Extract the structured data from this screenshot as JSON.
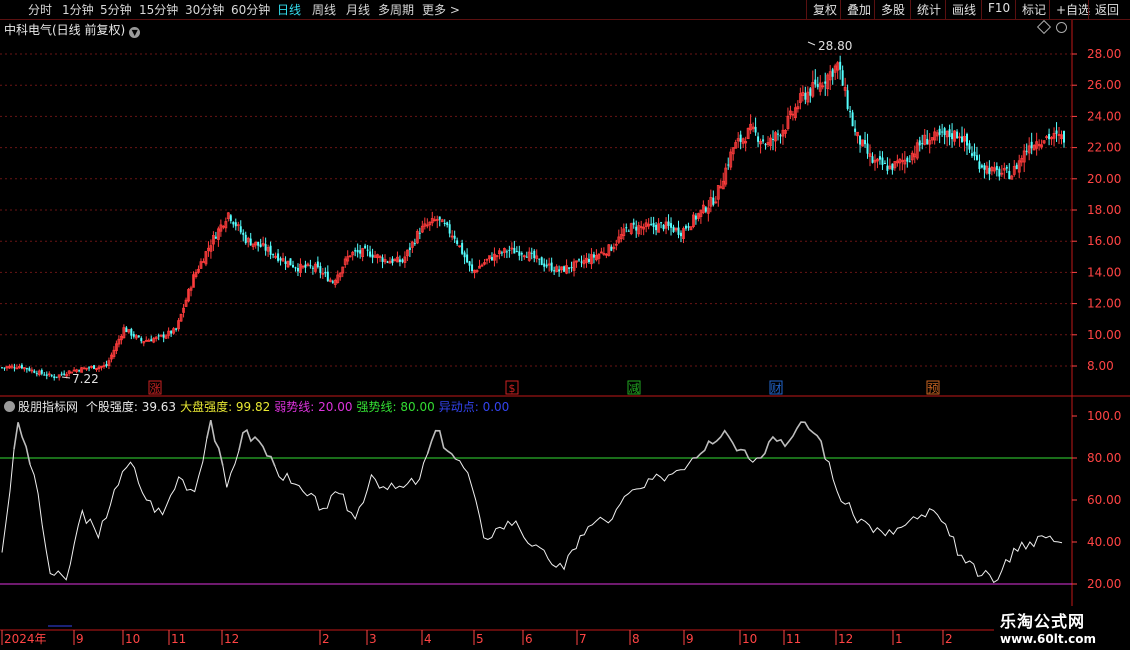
{
  "toolbar": {
    "periods": [
      "分时",
      "1分钟",
      "5分钟",
      "15分钟",
      "30分钟",
      "60分钟",
      "日线",
      "周线",
      "月线",
      "多周期",
      "更多 >"
    ],
    "active_period": "日线",
    "right_buttons": [
      "复权",
      "叠加",
      "多股",
      "统计",
      "画线",
      "F10",
      "标记",
      "+自选",
      "返回"
    ]
  },
  "stock": {
    "title": "中科电气(日线 前复权)"
  },
  "price_axis": {
    "labels": [
      "28.00",
      "26.00",
      "24.00",
      "22.00",
      "20.00",
      "18.00",
      "16.00",
      "14.00",
      "12.00",
      "10.00",
      "8.00"
    ]
  },
  "price_annotations": {
    "high": "28.80",
    "low": "7.22"
  },
  "event_markers": [
    {
      "label": "涨",
      "color": "#cc2222"
    },
    {
      "label": "$",
      "color": "#cc2222"
    },
    {
      "label": "减",
      "color": "#22aa22"
    },
    {
      "label": "财",
      "color": "#2266cc"
    },
    {
      "label": "预",
      "color": "#cc6622"
    }
  ],
  "indicator": {
    "name": "股朋指标网",
    "items": [
      {
        "label": "个股强度: 39.63",
        "color": "#e8e8e8"
      },
      {
        "label": "大盘强度: 99.82",
        "color": "#e8e833"
      },
      {
        "label": "弱势线: 20.00",
        "color": "#dd33dd"
      },
      {
        "label": "强势线: 80.00",
        "color": "#33dd33"
      },
      {
        "label": "异动点: 0.00",
        "color": "#3344ee"
      }
    ],
    "axis_labels": [
      "100.0",
      "80.00",
      "60.00",
      "40.00",
      "20.00"
    ]
  },
  "date_axis": {
    "labels": [
      "2024年",
      "9",
      "10",
      "11",
      "12",
      "2",
      "3",
      "4",
      "5",
      "6",
      "7",
      "8",
      "9",
      "10",
      "11",
      "12",
      "1",
      "2"
    ]
  },
  "watermark": {
    "line1": "乐淘公式网",
    "line2": "www.60lt.com"
  },
  "colors": {
    "up": "#ff3c3c",
    "down": "#54ffff",
    "weak_line": "#dd33dd",
    "strong_line": "#33dd33",
    "grid": "#6a1414",
    "axis": "#ff4444"
  },
  "chart_data": [
    {
      "type": "candlestick",
      "title": "中科电气(日线 前复权)",
      "ylim": [
        7,
        30
      ],
      "y_ticks": [
        8,
        10,
        12,
        14,
        16,
        18,
        20,
        22,
        24,
        26,
        28
      ],
      "x": [
        "2024年",
        "9",
        "10",
        "11",
        "12",
        "2",
        "3",
        "4",
        "5",
        "6",
        "7",
        "8",
        "9",
        "10",
        "11",
        "12",
        "1",
        "2"
      ],
      "series": [
        {
          "values": [
            7.9,
            8.0,
            7.6,
            7.3,
            7.7,
            7.9,
            8.0,
            10.4,
            9.6,
            9.8,
            10.3,
            13.7,
            15.9,
            17.8,
            16.1,
            15.6,
            14.9,
            14.3,
            14.3,
            13.4,
            15.2,
            15.3,
            14.8,
            14.7,
            16.7,
            17.4,
            16.3,
            14.0,
            14.9,
            15.4,
            15.3,
            14.6,
            14.1,
            14.5,
            15.0,
            15.6,
            16.9,
            16.9,
            17.0,
            16.6,
            17.7,
            18.8,
            22.0,
            23.1,
            22.2,
            23.4,
            25.3,
            26.1,
            27.3,
            22.9,
            21.1,
            20.7,
            21.3,
            22.5,
            22.7,
            22.9,
            21.1,
            20.4,
            20.3,
            22.2,
            22.7,
            22.6
          ]
        }
      ],
      "annotations": [
        {
          "text": "28.80",
          "kind": "high"
        },
        {
          "text": "7.22",
          "kind": "low"
        }
      ]
    },
    {
      "type": "line",
      "title": "股朋指标网",
      "ylim": [
        15,
        102
      ],
      "y_ticks": [
        20,
        40,
        60,
        80,
        100
      ],
      "series": [
        {
          "name": "个股强度",
          "values": [
            35,
            97,
            72,
            25,
            22,
            55,
            42,
            65,
            78,
            60,
            53,
            71,
            64,
            98,
            66,
            92,
            88,
            76,
            68,
            62,
            56,
            63,
            51,
            72,
            65,
            66,
            70,
            93,
            82,
            73,
            42,
            47,
            50,
            38,
            32,
            27,
            43,
            50,
            51,
            63,
            66,
            71,
            74,
            80,
            88,
            93,
            84,
            80,
            90,
            88,
            97,
            88,
            64,
            53,
            48,
            43,
            47,
            51,
            55,
            43,
            30,
            24,
            22,
            37,
            40,
            42,
            39.63
          ]
        },
        {
          "name": "弱势线",
          "values": [
            20
          ]
        },
        {
          "name": "强势线",
          "values": [
            80
          ]
        },
        {
          "name": "异动点",
          "values": [
            0
          ]
        }
      ]
    }
  ]
}
